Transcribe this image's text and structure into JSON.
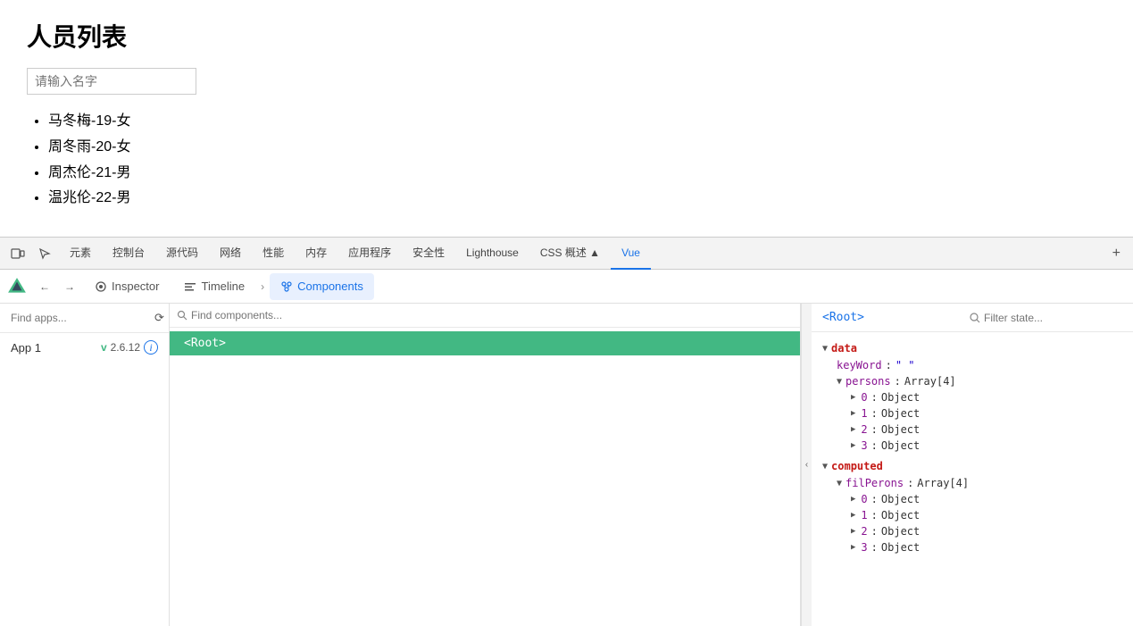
{
  "page": {
    "title": "人员列表",
    "search_placeholder": "请输入名字",
    "persons": [
      "马冬梅-19-女",
      "周冬雨-20-女",
      "周杰伦-21-男",
      "温兆伦-22-男"
    ]
  },
  "devtools": {
    "toolbar_tabs": [
      {
        "label": "元素",
        "active": false
      },
      {
        "label": "控制台",
        "active": false
      },
      {
        "label": "源代码",
        "active": false
      },
      {
        "label": "网络",
        "active": false
      },
      {
        "label": "性能",
        "active": false
      },
      {
        "label": "内存",
        "active": false
      },
      {
        "label": "应用程序",
        "active": false
      },
      {
        "label": "安全性",
        "active": false
      },
      {
        "label": "Lighthouse",
        "active": false
      },
      {
        "label": "CSS 概述 ▲",
        "active": false
      },
      {
        "label": "Vue",
        "active": true
      }
    ],
    "vue_tabs": [
      {
        "label": "Inspector",
        "active": true,
        "icon": "inspector"
      },
      {
        "label": "Timeline",
        "active": false,
        "icon": "timeline"
      },
      {
        "label": "Components",
        "active": true,
        "icon": "components"
      }
    ],
    "left_panel": {
      "search_placeholder": "Find apps...",
      "app_label": "App 1",
      "app_version": "2.6.12"
    },
    "center_panel": {
      "search_placeholder": "Find components...",
      "root_label": "<Root>"
    },
    "right_panel": {
      "root_label": "<Root>",
      "filter_placeholder": "Filter state...",
      "data_section": {
        "name": "data",
        "items": [
          {
            "key": "keyWord",
            "value": "\" \"",
            "type": "string"
          },
          {
            "key": "persons",
            "value": "Array[4]",
            "type": "array",
            "children": [
              {
                "key": "0",
                "value": "Object"
              },
              {
                "key": "1",
                "value": "Object"
              },
              {
                "key": "2",
                "value": "Object"
              },
              {
                "key": "3",
                "value": "Object"
              }
            ]
          }
        ]
      },
      "computed_section": {
        "name": "computed",
        "items": [
          {
            "key": "filPerons",
            "value": "Array[4]",
            "type": "array",
            "children": [
              {
                "key": "0",
                "value": "Object"
              },
              {
                "key": "1",
                "value": "Object"
              },
              {
                "key": "2",
                "value": "Object"
              },
              {
                "key": "3",
                "value": "Object"
              }
            ]
          }
        ]
      }
    }
  }
}
